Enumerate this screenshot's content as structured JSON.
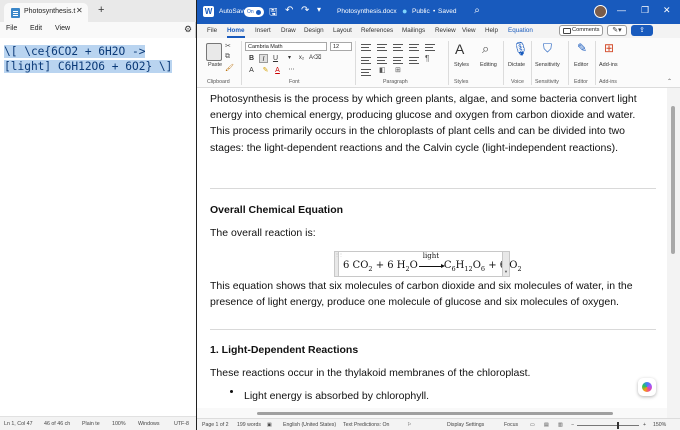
{
  "notepad": {
    "tab_title": "Photosynthesis.t",
    "menu": [
      "File",
      "Edit",
      "View"
    ],
    "lines": [
      "\\[ \\ce{6CO2 + 6H2O ->",
      "[light] C6H12O6 + 6O2} \\]"
    ],
    "status": {
      "position": "Ln 1, Col 47",
      "selection": "46 of 46 ch",
      "format": "Plain te",
      "zoom": "100%",
      "line_ending": "Windows",
      "encoding": "UTF-8"
    }
  },
  "word": {
    "title": {
      "autosave": "AutoSave",
      "toggle": "On",
      "filename": "Photosynthesis.docx",
      "sensitivity": "Public",
      "saved": "Saved"
    },
    "tabs": [
      "File",
      "Home",
      "Insert",
      "Draw",
      "Design",
      "Layout",
      "References",
      "Mailings",
      "Review",
      "View",
      "Help",
      "Equation"
    ],
    "comments_label": "Comments",
    "ribbon": {
      "font_name": "Cambria Math",
      "font_size": "12",
      "groups": {
        "clipboard": "Clipboard",
        "font": "Font",
        "paragraph": "Paragraph",
        "styles": "Styles",
        "voice": "Voice",
        "sensitivity": "Sensitivity",
        "editor": "Editor",
        "addins": "Add-ins"
      },
      "buttons": {
        "paste": "Paste",
        "styles": "Styles",
        "editing": "Editing",
        "dictate": "Dictate",
        "sensitivity": "Sensitivity",
        "editor": "Editor",
        "addins": "Add-ins"
      }
    },
    "document": {
      "intro": "Photosynthesis is the process by which green plants, algae, and some bacteria convert light energy into chemical energy, producing glucose and oxygen from carbon dioxide and water. This process primarily occurs in the chloroplasts of plant cells and can be divided into two stages: the light-dependent reactions and the Calvin cycle (light-independent reactions).",
      "h_overall": "Overall Chemical Equation",
      "overall_reaction": "The overall reaction is:",
      "equation": {
        "left": "6 CO",
        "left_sub": "2",
        "plus1": " + 6 H",
        "h2o_sub": "2",
        "o": "O",
        "arrow_label": "light",
        "c": "C",
        "c_sub": "6",
        "h": "H",
        "h_sub": "12",
        "o2": "O",
        "o_sub": "6",
        "plus2": " + 6 O",
        "o2_sub": "2"
      },
      "explain": "This equation shows that six molecules of carbon dioxide and six molecules of water, in the presence of light energy, produce one molecule of glucose and six molecules of oxygen.",
      "h_light": "1. Light-Dependent Reactions",
      "light_text": "These reactions occur in the thylakoid membranes of the chloroplast.",
      "bullet1": "Light energy is absorbed by chlorophyll."
    },
    "status": {
      "page": "Page 1 of 2",
      "words": "199 words",
      "language": "English (United States)",
      "predictions": "Text Predictions: On",
      "display": "Display Settings",
      "focus": "Focus",
      "zoom": "150%"
    }
  },
  "colors": {
    "word_blue": "#185abd",
    "selection": "#b9d4f0"
  }
}
